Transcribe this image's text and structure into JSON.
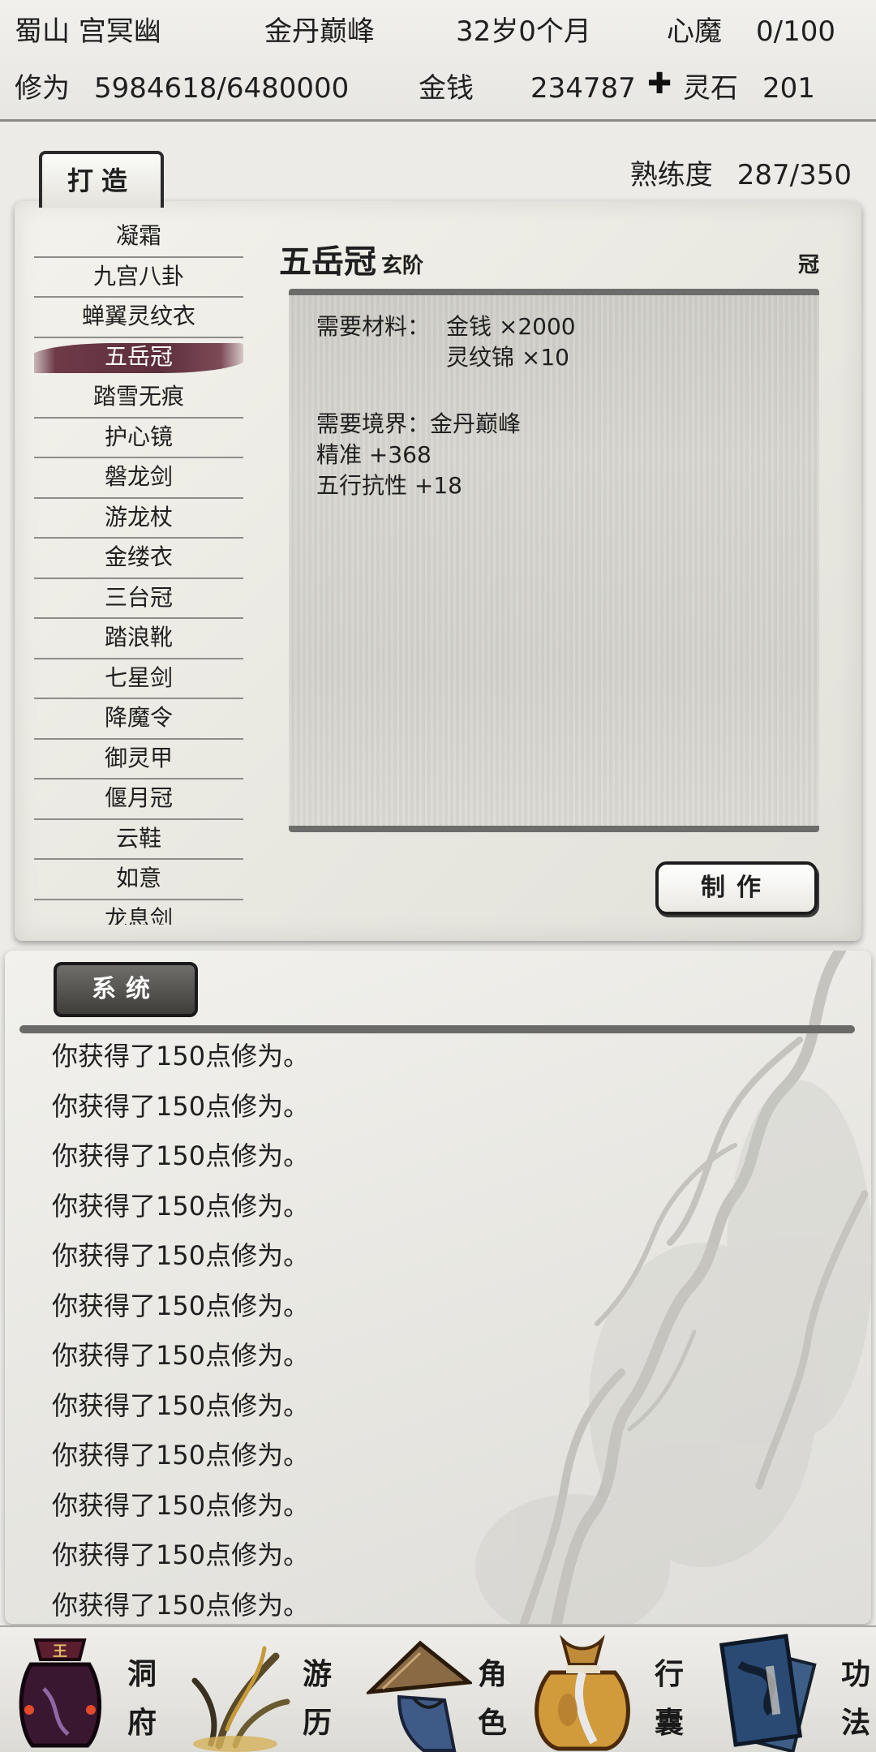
{
  "status": {
    "player_name": "蜀山 宫冥幽",
    "realm": "金丹巅峰",
    "age": "32岁0个月",
    "heart_demon_label": "心魔",
    "heart_demon_value": "0/100",
    "cultivation_label": "修为",
    "cultivation_value": "5984618/6480000",
    "money_label": "金钱",
    "money_value": "234787",
    "spirit_stone_label": "灵石",
    "spirit_stone_value": "201"
  },
  "forge": {
    "tab_label": "打造",
    "proficiency_label": "熟练度",
    "proficiency_value": "287/350",
    "recipes": [
      "凝霜",
      "九宫八卦",
      "蝉翼灵纹衣",
      "五岳冠",
      "踏雪无痕",
      "护心镜",
      "磐龙剑",
      "游龙杖",
      "金缕衣",
      "三台冠",
      "踏浪靴",
      "七星剑",
      "降魔令",
      "御灵甲",
      "偃月冠",
      "云鞋",
      "如意",
      "龙息剑"
    ],
    "selected_index": 3,
    "detail": {
      "name": "五岳冠",
      "grade": "玄阶",
      "type": "冠",
      "materials_label": "需要材料：",
      "material_1": "金钱  ×2000",
      "material_2": "灵纹锦  ×10",
      "realm_req": "需要境界：金丹巅峰",
      "stat_1": "精准 +368",
      "stat_2": "五行抗性 +18"
    },
    "craft_label": "制作"
  },
  "log": {
    "tab_label": "系统",
    "lines": [
      "你获得了150点修为。",
      "你获得了150点修为。",
      "你获得了150点修为。",
      "你获得了150点修为。",
      "你获得了150点修为。",
      "你获得了150点修为。",
      "你获得了150点修为。",
      "你获得了150点修为。",
      "你获得了150点修为。",
      "你获得了150点修为。",
      "你获得了150点修为。",
      "你获得了150点修为。"
    ]
  },
  "nav": {
    "items": [
      {
        "label_top": "洞",
        "label_bottom": "府",
        "icon": "palace-bag-icon"
      },
      {
        "label_top": "游",
        "label_bottom": "历",
        "icon": "herb-icon"
      },
      {
        "label_top": "角",
        "label_bottom": "色",
        "icon": "bamboo-hat-icon"
      },
      {
        "label_top": "行",
        "label_bottom": "囊",
        "icon": "gold-pouch-icon"
      },
      {
        "label_top": "功",
        "label_bottom": "法",
        "icon": "scroll-books-icon"
      }
    ]
  },
  "colors": {
    "required_material_missing": "#e31c1c",
    "selected_recipe": "#5c2e3c"
  }
}
